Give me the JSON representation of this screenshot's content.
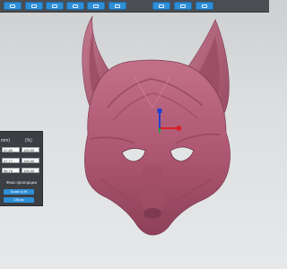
{
  "toolbar": {
    "buttons": [
      {
        "icon": "grid-icon"
      },
      {
        "icon": "folder-icon"
      },
      {
        "icon": "zoom-icon"
      },
      {
        "icon": "move-icon"
      },
      {
        "icon": "window-icon"
      },
      {
        "icon": "layers-icon"
      },
      {
        "icon": "paint-icon"
      },
      {
        "icon": "fullscreen-icon"
      },
      {
        "icon": "settings-icon"
      }
    ]
  },
  "panel": {
    "col_units": "mm)",
    "col_percent": "(%)",
    "rows": [
      {
        "mm": "47.85",
        "pct": "100,00"
      },
      {
        "mm": "47.77",
        "pct": "100,00"
      },
      {
        "mm": "56.76",
        "pct": "100,00"
      }
    ],
    "fix_proportions": "Фикс.пропорции",
    "scale_to_fit": "Scale to fit",
    "reset": "Сброс"
  },
  "colors": {
    "mask": "#b7607a",
    "mask_dark": "#7e3a50",
    "accent": "#2f8fd6"
  }
}
